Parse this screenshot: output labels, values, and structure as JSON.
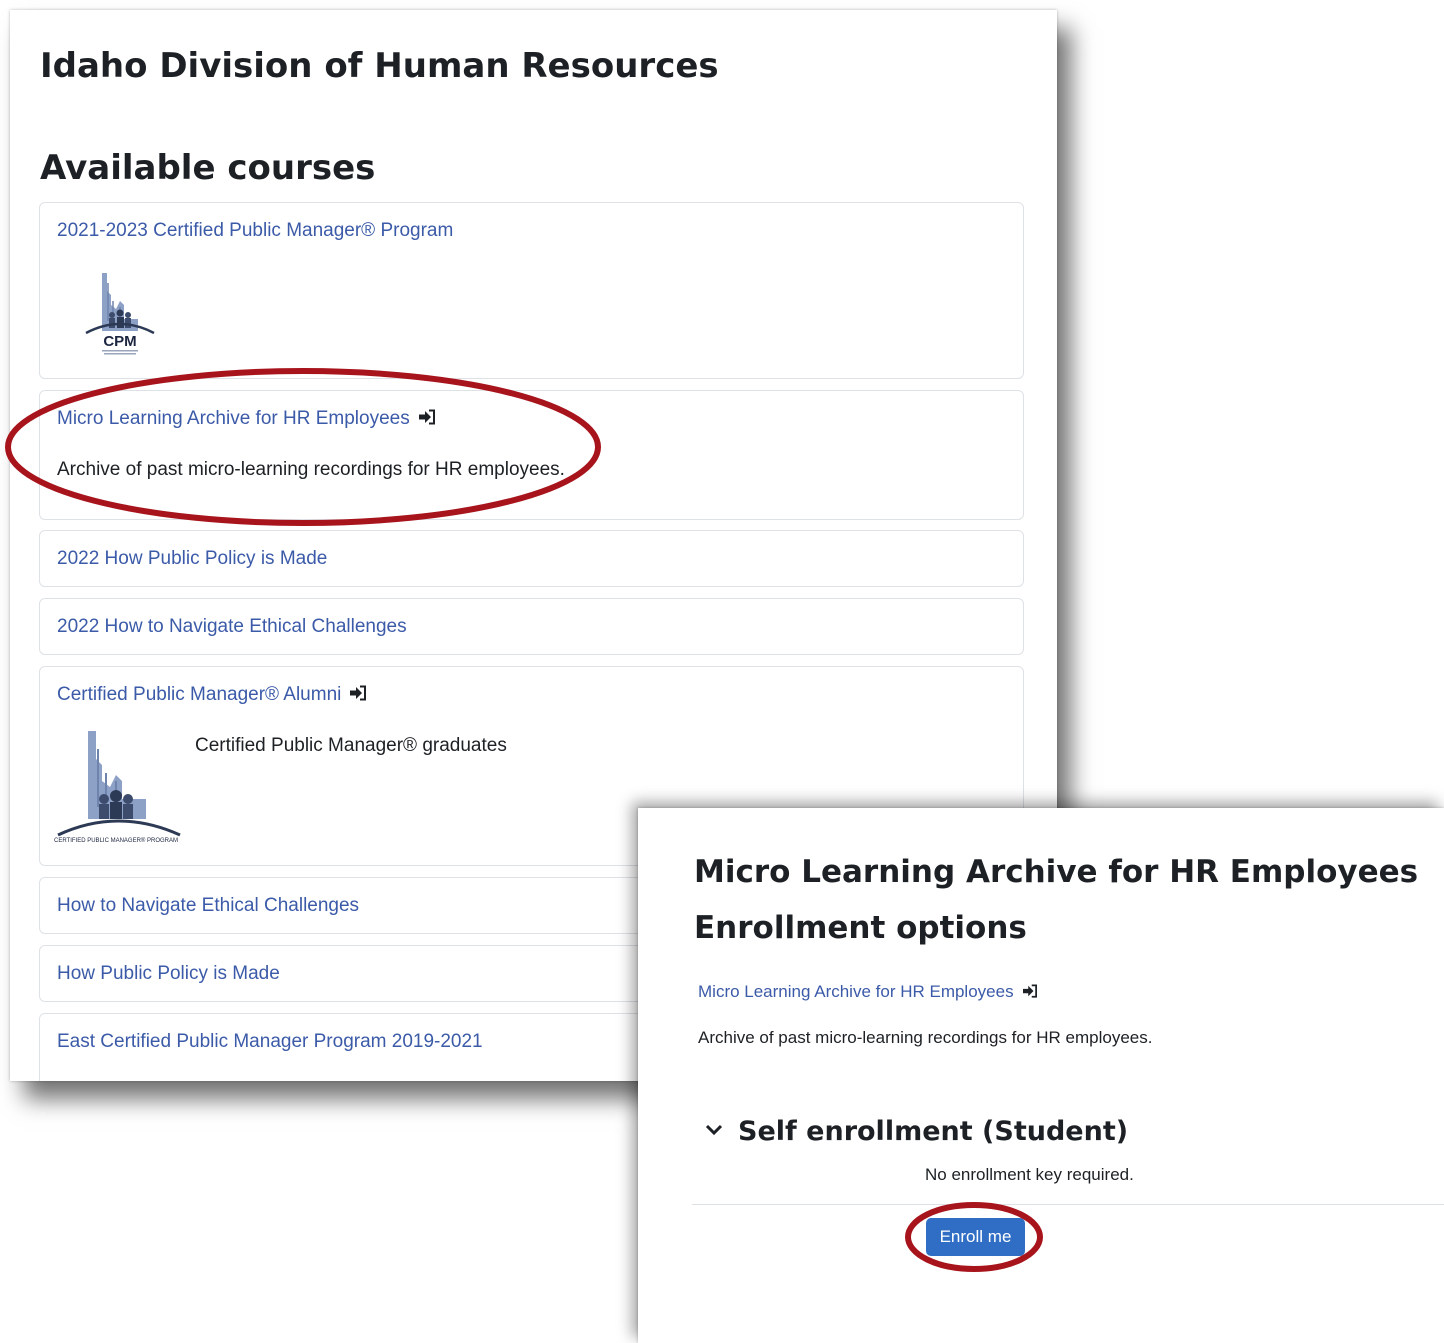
{
  "site": {
    "title": "Idaho Division of Human Resources"
  },
  "available_courses": {
    "heading": "Available courses",
    "courses": [
      {
        "name": "2021-2023 Certified Public Manager® Program",
        "logo_text": "CPM"
      },
      {
        "name": "Micro Learning Archive for HR Employees",
        "summary": "Archive of past micro-learning recordings for HR employees.",
        "enrol_icon": "sign-in-icon"
      },
      {
        "name": "2022 How Public Policy is Made"
      },
      {
        "name": "2022 How to Navigate Ethical Challenges"
      },
      {
        "name": "Certified Public Manager® Alumni",
        "summary": "Certified Public Manager® graduates",
        "enrol_icon": "sign-in-icon",
        "logo_caption": "CERTIFIED PUBLIC MANAGER® PROGRAM"
      },
      {
        "name": "How to Navigate Ethical Challenges"
      },
      {
        "name": "How Public Policy is Made"
      },
      {
        "name": "East Certified Public Manager Program 2019-2021"
      }
    ]
  },
  "enrollment": {
    "title": "Micro Learning Archive for HR Employees",
    "subtitle": "Enrollment options",
    "course_link": "Micro Learning Archive for HR Employees",
    "summary": "Archive of past micro-learning recordings for HR employees.",
    "method_heading": "Self enrollment (Student)",
    "method_note": "No enrollment key required.",
    "enrol_button": "Enroll me"
  },
  "colors": {
    "link": "#3b5aa8",
    "button": "#2f6ec4",
    "annotation": "#a8141c",
    "logo": "#8da1c6"
  }
}
